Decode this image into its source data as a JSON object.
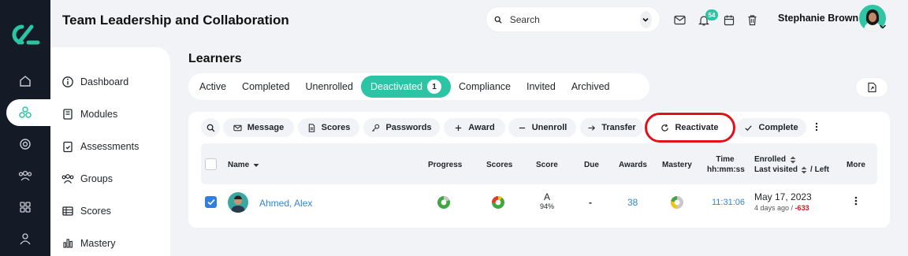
{
  "colors": {
    "accent": "#2bc4a4",
    "rail": "#141b26",
    "link": "#2f86d6",
    "negative": "#e3101b",
    "highlight": "#e3101b"
  },
  "header": {
    "title": "Team Leadership and Collaboration",
    "search_placeholder": "Search",
    "notification_count": "54",
    "user_name": "Stephanie Brown"
  },
  "rail": {
    "icons": [
      "home-icon",
      "modules-cluster-icon",
      "target-icon",
      "people-icon",
      "grid-icon",
      "user-icon"
    ]
  },
  "sidebar": {
    "items": [
      {
        "label": "Dashboard",
        "icon": "info-circle-icon"
      },
      {
        "label": "Modules",
        "icon": "book-icon"
      },
      {
        "label": "Assessments",
        "icon": "clipboard-icon"
      },
      {
        "label": "Groups",
        "icon": "group-icon"
      },
      {
        "label": "Scores",
        "icon": "table-icon"
      },
      {
        "label": "Mastery",
        "icon": "bar-chart-icon"
      }
    ]
  },
  "learners": {
    "heading": "Learners",
    "tabs": [
      {
        "label": "Active"
      },
      {
        "label": "Completed"
      },
      {
        "label": "Unenrolled"
      },
      {
        "label": "Deactivated",
        "count": "1",
        "active": true
      },
      {
        "label": "Compliance"
      },
      {
        "label": "Invited"
      },
      {
        "label": "Archived"
      }
    ],
    "toolbar": {
      "message": "Message",
      "scores": "Scores",
      "passwords": "Passwords",
      "award": "Award",
      "unenroll": "Unenroll",
      "transfer": "Transfer",
      "reactivate": "Reactivate",
      "complete": "Complete"
    },
    "columns": {
      "name": "Name",
      "progress": "Progress",
      "scores": "Scores",
      "score": "Score",
      "due": "Due",
      "awards": "Awards",
      "mastery": "Mastery",
      "time": "Time",
      "time_format": "hh:mm:ss",
      "enrolled": "Enrolled",
      "last_visited": "Last visited",
      "left": "/ Left",
      "more": "More"
    },
    "rows": [
      {
        "name": "Ahmed, Alex",
        "selected": true,
        "grade": "A",
        "percent": "94%",
        "due": "-",
        "awards": "38",
        "time": "11:31:06",
        "enrolled": "May 17, 2023",
        "last_visited": "4 days ago /",
        "left": "-633"
      }
    ]
  }
}
